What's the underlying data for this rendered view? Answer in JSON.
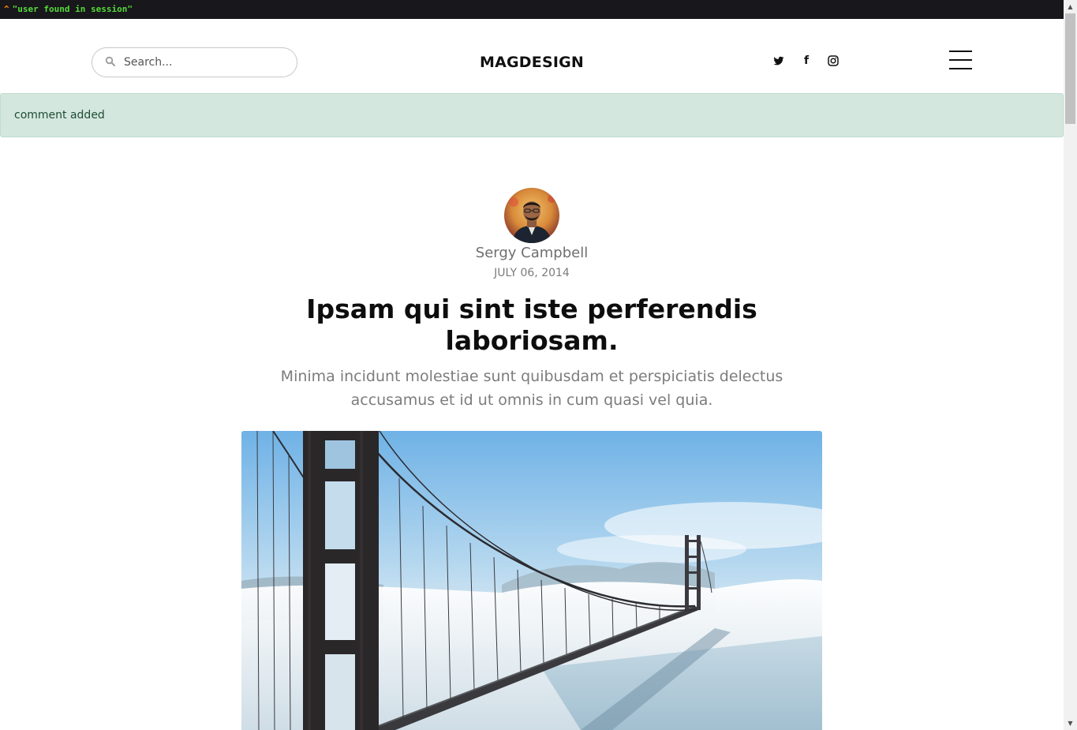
{
  "debug": {
    "caret": "^",
    "message": "\"user found in session\""
  },
  "header": {
    "search_placeholder": "Search...",
    "logo": "MAGDESIGN",
    "social": [
      {
        "icon": "twitter-icon"
      },
      {
        "icon": "facebook-icon",
        "glyph": "f"
      },
      {
        "icon": "instagram-icon"
      }
    ],
    "menu_icon": "hamburger-menu-icon"
  },
  "alert": {
    "message": "comment added",
    "color": "#d4e7de"
  },
  "article": {
    "author": "Sergy Campbell",
    "date": "JULY 06, 2014",
    "title": "Ipsam qui sint iste perferendis laboriosam.",
    "subtitle": "Minima incidunt molestiae sunt quibusdam et perspiciatis delectus accusamus et id ut omnis in cum quasi vel quia."
  }
}
